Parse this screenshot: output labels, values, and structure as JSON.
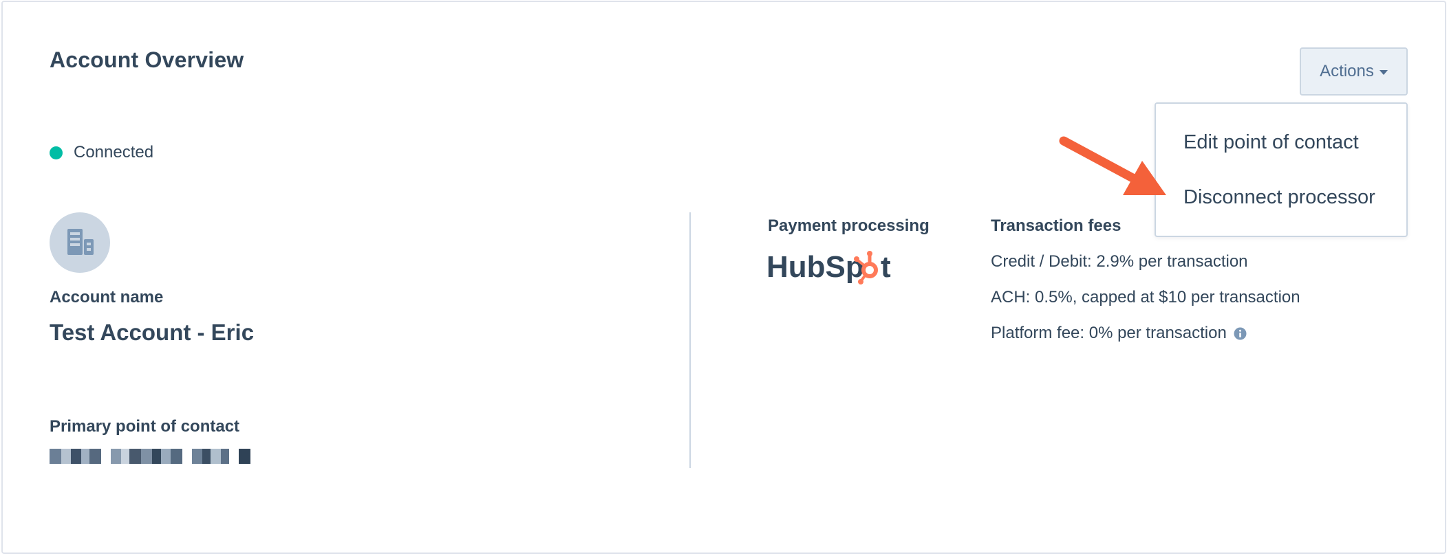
{
  "page": {
    "title": "Account Overview"
  },
  "status": {
    "label": "Connected",
    "color": "#00bda5"
  },
  "account": {
    "avatar_icon": "building-icon",
    "name_label": "Account name",
    "name_value": "Test Account - Eric",
    "contact_label": "Primary point of contact"
  },
  "payment": {
    "label": "Payment processing",
    "logo_text_a": "HubSp",
    "logo_text_b": "t",
    "brand_color": "#ff7a59"
  },
  "fees": {
    "label": "Transaction fees",
    "credit_debit": "Credit / Debit: 2.9% per transaction",
    "ach": "ACH: 0.5%, capped at $10 per transaction",
    "platform": "Platform fee: 0% per transaction",
    "info_icon": "info-icon"
  },
  "actions": {
    "button_label": "Actions",
    "menu_items": [
      "Edit point of contact",
      "Disconnect processor"
    ]
  },
  "annotation": {
    "arrow_color": "#f4613a"
  }
}
